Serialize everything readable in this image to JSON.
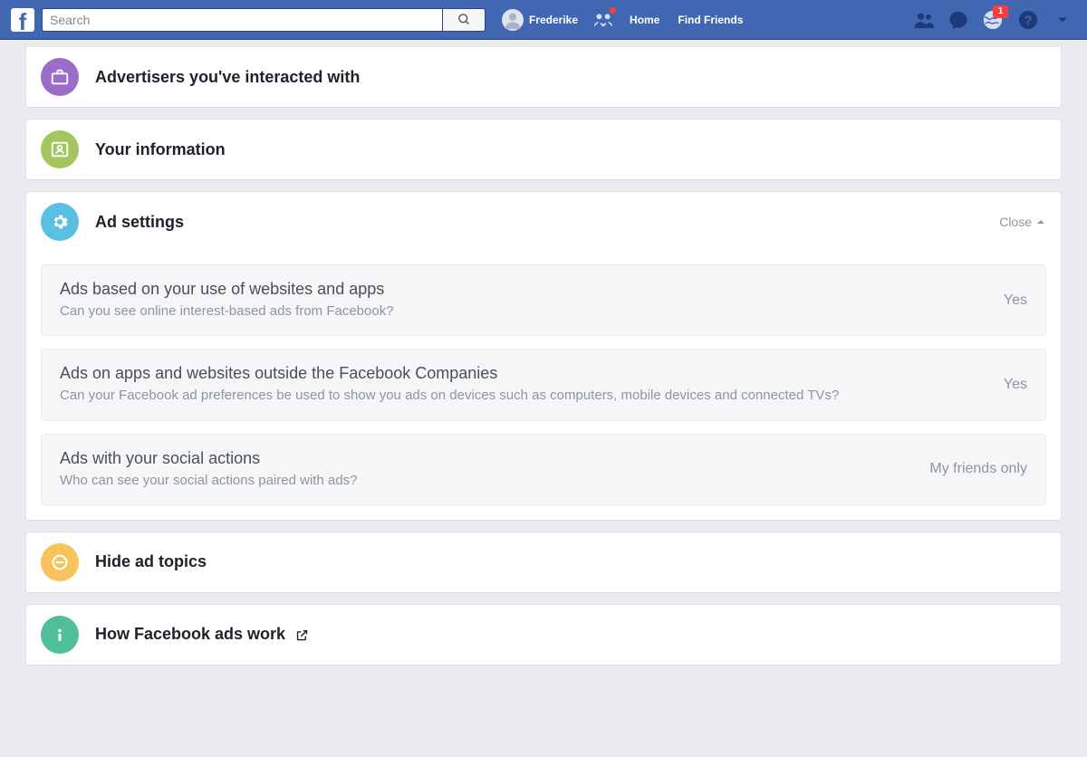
{
  "topbar": {
    "search_placeholder": "Search",
    "profile_name": "Frederike",
    "home": "Home",
    "find_friends": "Find Friends",
    "notifications_count": "1"
  },
  "sections": {
    "advertisers_title": "Advertisers you've interacted with",
    "your_info_title": "Your information",
    "ad_settings_title": "Ad settings",
    "ad_settings_close": "Close",
    "hide_topics_title": "Hide ad topics",
    "how_ads_work_title": "How Facebook ads work"
  },
  "ad_settings": [
    {
      "title": "Ads based on your use of websites and apps",
      "desc": "Can you see online interest-based ads from Facebook?",
      "value": "Yes"
    },
    {
      "title": "Ads on apps and websites outside the Facebook Companies",
      "desc": "Can your Facebook ad preferences be used to show you ads on devices such as computers, mobile devices and connected TVs?",
      "value": "Yes"
    },
    {
      "title": "Ads with your social actions",
      "desc": "Who can see your social actions paired with ads?",
      "value": "My friends only"
    }
  ],
  "colors": {
    "advertisers": "#9b6cc9",
    "your_info": "#a3c65f",
    "ad_settings": "#59c0e2",
    "hide_topics": "#f7c35a",
    "how_ads": "#4ebf9a"
  }
}
